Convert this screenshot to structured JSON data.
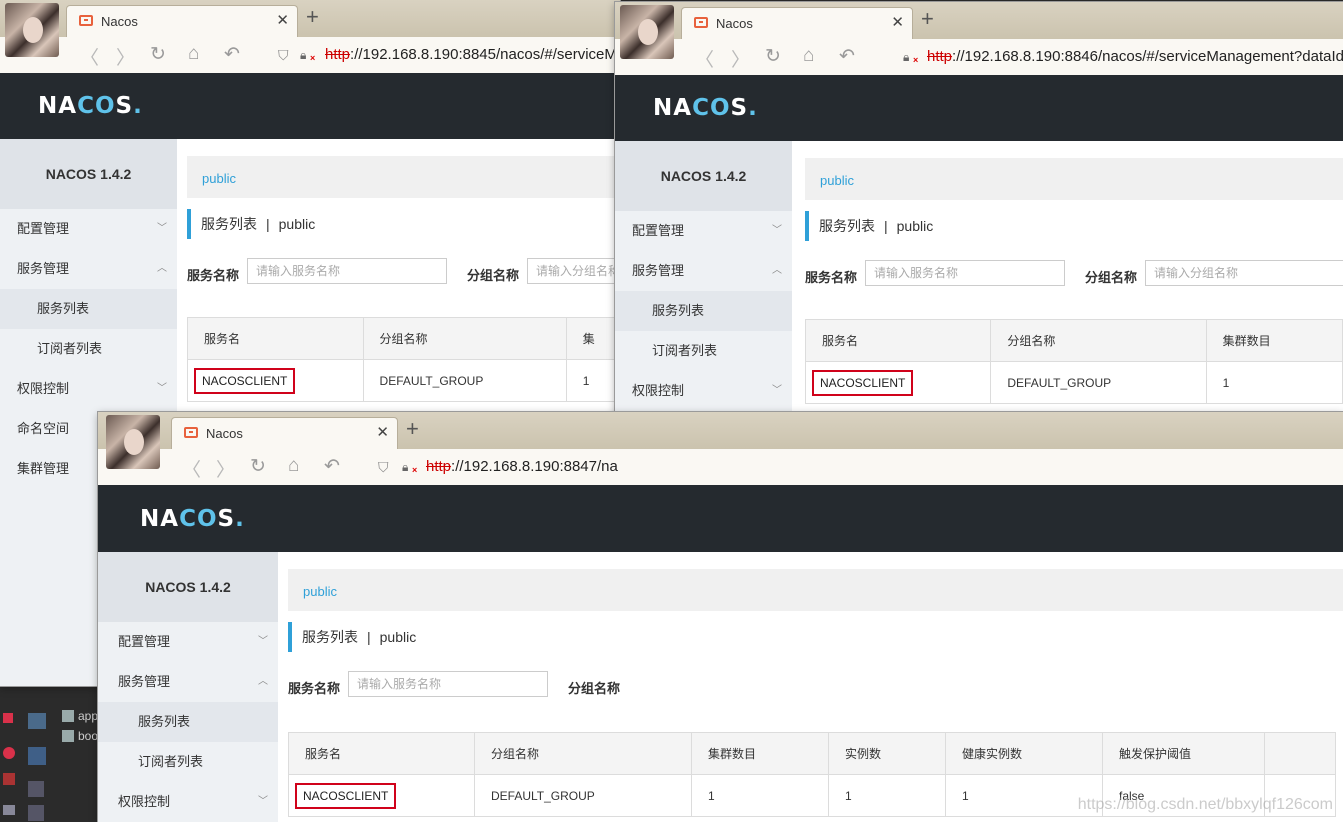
{
  "windows": [
    {
      "id": "w1",
      "tab_title": "Nacos",
      "url_scheme": "http",
      "url_rest": "://192.168.8.190:8845/nacos/#/serviceM",
      "version": "NACOS 1.4.2",
      "namespace": "public",
      "page_title": "服务列表",
      "page_ns": "public",
      "filter_service_label": "服务名称",
      "filter_service_placeholder": "请输入服务名称",
      "filter_group_label": "分组名称",
      "filter_group_placeholder": "请输入分组名称",
      "columns": [
        "服务名",
        "分组名称",
        "集"
      ],
      "row": [
        "NACOSCLIENT",
        "DEFAULT_GROUP",
        "1"
      ]
    },
    {
      "id": "w2",
      "tab_title": "Nacos",
      "url_scheme": "http",
      "url_rest": "://192.168.8.190:8846/nacos/#/serviceManagement?dataId",
      "version": "NACOS 1.4.2",
      "namespace": "public",
      "page_title": "服务列表",
      "page_ns": "public",
      "filter_service_label": "服务名称",
      "filter_service_placeholder": "请输入服务名称",
      "filter_group_label": "分组名称",
      "filter_group_placeholder": "请输入分组名称",
      "columns": [
        "服务名",
        "分组名称",
        "集群数目"
      ],
      "row": [
        "NACOSCLIENT",
        "DEFAULT_GROUP",
        "1"
      ]
    },
    {
      "id": "w3",
      "tab_title": "Nacos",
      "url_scheme": "http",
      "url_rest": "://192.168.8.190:8847/na",
      "version": "NACOS 1.4.2",
      "namespace": "public",
      "page_title": "服务列表",
      "page_ns": "public",
      "filter_service_label": "服务名称",
      "filter_service_placeholder": "请输入服务名称",
      "filter_group_label": "分组名称",
      "columns": [
        "服务名",
        "分组名称",
        "集群数目",
        "实例数",
        "健康实例数",
        "触发保护阈值"
      ],
      "row": [
        "NACOSCLIENT",
        "DEFAULT_GROUP",
        "1",
        "1",
        "1",
        "false"
      ]
    }
  ],
  "logo": {
    "na": "NA",
    "co": "CO",
    "s": "S",
    "dot": "."
  },
  "menu": {
    "config": "配置管理",
    "service": "服务管理",
    "service_list": "服务列表",
    "subscriber_list": "订阅者列表",
    "auth": "权限控制",
    "namespace": "命名空间",
    "cluster": "集群管理"
  },
  "taskbar": {
    "item1": "app",
    "item2": "boo"
  },
  "watermark": "https://blog.csdn.net/bbxylqf126com",
  "colors": {
    "accent": "#2fa0d8",
    "header": "#252a2f",
    "highlight": "#d0021b",
    "logo_accent": "#5fc2ea"
  }
}
